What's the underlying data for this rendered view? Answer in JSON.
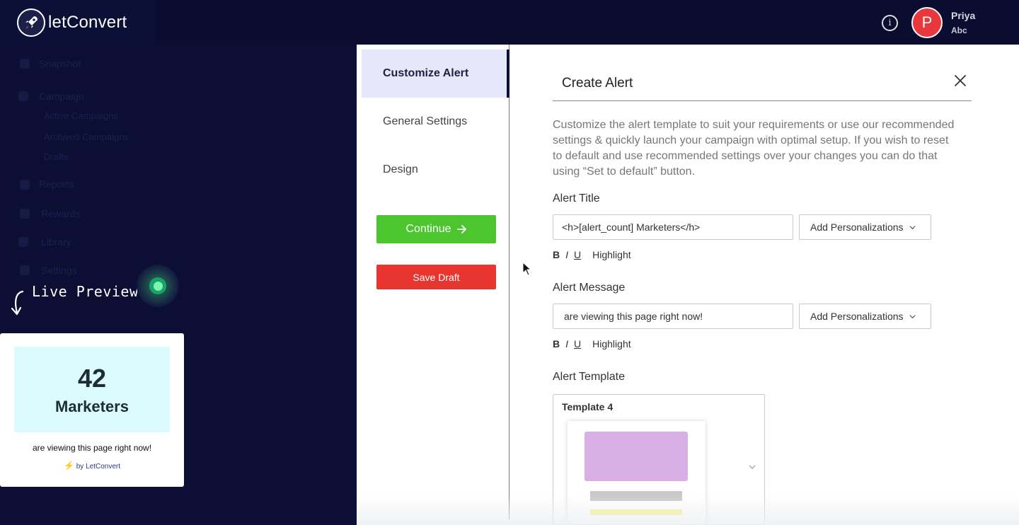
{
  "app": {
    "logo_text": "letConvert",
    "user_name": "Priya",
    "user_org": "Abc",
    "avatar_initial": "P"
  },
  "sidebar": {
    "ghost_items": [
      "Snapshot",
      "Campaign",
      "Active Campaigns",
      "Archived Campaigns",
      "Drafts",
      "Reports",
      "Rewards",
      "Library",
      "Settings"
    ]
  },
  "preview": {
    "label": "Live Preview",
    "count": "42",
    "title": "Marketers",
    "message": "are viewing this page right now!",
    "brand": "by LetConvert"
  },
  "steps": {
    "items": [
      {
        "label": "Customize Alert",
        "active": true
      },
      {
        "label": "General Settings",
        "active": false
      },
      {
        "label": "Design",
        "active": false
      }
    ],
    "continue_label": "Continue",
    "save_draft_label": "Save Draft"
  },
  "content": {
    "title": "Create Alert",
    "description": "Customize the alert template to suit your requirements or use our recommended settings & quickly launch your campaign with optimal setup. If you wish to reset to default and use recommended settings over your changes you can do that using “Set to default” button.",
    "alert_title": {
      "label": "Alert Title",
      "value": "<h>[alert_count] Marketers</h>",
      "personalize_label": "Add Personalizations"
    },
    "alert_message": {
      "label": "Alert Message",
      "value": "are viewing this page right now!",
      "personalize_label": "Add Personalizations"
    },
    "format": {
      "bold": "B",
      "italic": "I",
      "underline": "U",
      "highlight": "Highlight"
    },
    "alert_template": {
      "label": "Alert Template",
      "selected": "Template 4"
    }
  },
  "colors": {
    "background": "#0c0e33",
    "continue": "#4cc52e",
    "save_draft": "#e8352f",
    "avatar": "#e8383d",
    "active_step": "#e7e7fb",
    "preview_hero": "#dcfbfd"
  }
}
